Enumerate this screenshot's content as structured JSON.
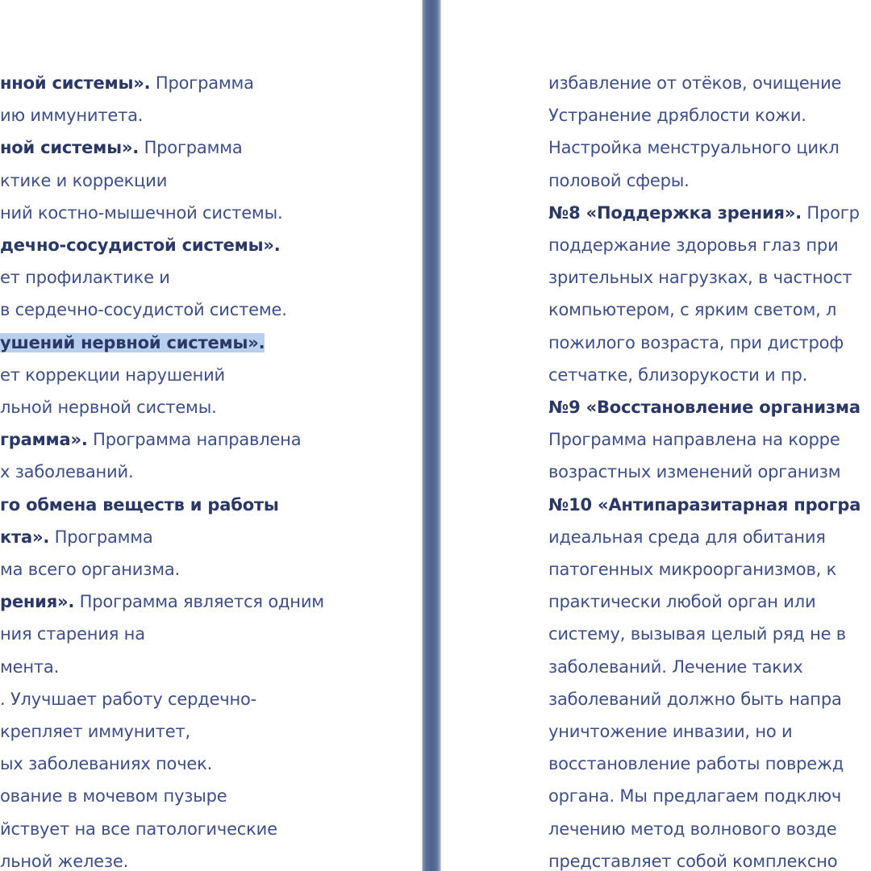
{
  "document": {
    "left_page": [
      [
        {
          "t": "нной системы».",
          "b": true
        },
        {
          "t": " Программа",
          "b": false
        }
      ],
      [
        {
          "t": "ию иммунитета.",
          "b": false
        }
      ],
      [
        {
          "t": "ной системы».",
          "b": true
        },
        {
          "t": " Программа",
          "b": false
        }
      ],
      [
        {
          "t": "ктике и коррекции",
          "b": false
        }
      ],
      [
        {
          "t": "ний костно-мышечной системы.",
          "b": false
        }
      ],
      [
        {
          "t": "дечно-сосудистой системы».",
          "b": true
        }
      ],
      [
        {
          "t": "ет профилактике и",
          "b": false
        }
      ],
      [
        {
          "t": "в сердечно-сосудистой системе.",
          "b": false
        }
      ],
      [
        {
          "t": "ушений нервной системы».",
          "b": true,
          "hl": true
        }
      ],
      [
        {
          "t": "ет коррекции нарушений",
          "b": false
        }
      ],
      [
        {
          "t": "льной нервной системы.",
          "b": false
        }
      ],
      [
        {
          "t": "грамма».",
          "b": true
        },
        {
          "t": " Программа направлена",
          "b": false
        }
      ],
      [
        {
          "t": "х заболеваний.",
          "b": false
        }
      ],
      [
        {
          "t": "го обмена веществ и работы",
          "b": true
        }
      ],
      [
        {
          "t": "кта».",
          "b": true
        },
        {
          "t": " Программа",
          "b": false
        }
      ],
      [
        {
          "t": "ма всего организма.",
          "b": false
        }
      ],
      [
        {
          "t": "рения».",
          "b": true
        },
        {
          "t": " Программа является одним",
          "b": false
        }
      ],
      [
        {
          "t": "ния старения на",
          "b": false
        }
      ],
      [
        {
          "t": "мента.",
          "b": false
        }
      ],
      [
        {
          "t": ". Улучшает работу сердечно-",
          "b": false
        }
      ],
      [
        {
          "t": "крепляет иммунитет,",
          "b": false
        }
      ],
      [
        {
          "t": "ых заболеваниях почек.",
          "b": false
        }
      ],
      [
        {
          "t": "ование в мочевом пузыре",
          "b": false
        }
      ],
      [
        {
          "t": "йствует на все патологические",
          "b": false
        }
      ],
      [
        {
          "t": "льной железе.",
          "b": false
        }
      ]
    ],
    "right_page": [
      [
        {
          "t": "избавление от отёков, очищение",
          "b": false
        }
      ],
      [
        {
          "t": "Устранение дряблости кожи.",
          "b": false
        }
      ],
      [
        {
          "t": "Настройка менструального цикл",
          "b": false
        }
      ],
      [
        {
          "t": "половой сферы.",
          "b": false
        }
      ],
      [
        {
          "t": "№8 «Поддержка зрения».",
          "b": true
        },
        {
          "t": " Прогр",
          "b": false
        }
      ],
      [
        {
          "t": "поддержание здоровья глаз при",
          "b": false
        }
      ],
      [
        {
          "t": "зрительных нагрузках, в частност",
          "b": false
        }
      ],
      [
        {
          "t": "компьютером, с ярким светом, л",
          "b": false
        }
      ],
      [
        {
          "t": "пожилого возраста, при дистроф",
          "b": false
        }
      ],
      [
        {
          "t": "сетчатке, близорукости и пр.",
          "b": false
        }
      ],
      [
        {
          "t": "№9 «Восстановление организма",
          "b": true
        }
      ],
      [
        {
          "t": "Программа направлена на корре",
          "b": false
        }
      ],
      [
        {
          "t": "возрастных изменений организм",
          "b": false
        }
      ],
      [
        {
          "t": "№10 «Антипаразитарная програ",
          "b": true
        }
      ],
      [
        {
          "t": "идеальная среда для обитания",
          "b": false
        }
      ],
      [
        {
          "t": "патогенных микроорганизмов, к",
          "b": false
        }
      ],
      [
        {
          "t": "практически любой орган или",
          "b": false
        }
      ],
      [
        {
          "t": "систему, вызывая целый ряд не в",
          "b": false
        }
      ],
      [
        {
          "t": "заболеваний. Лечение таких",
          "b": false
        }
      ],
      [
        {
          "t": "заболеваний должно быть напра",
          "b": false
        }
      ],
      [
        {
          "t": "уничтожение инвазии, но и",
          "b": false
        }
      ],
      [
        {
          "t": "восстановление работы поврежд",
          "b": false
        }
      ],
      [
        {
          "t": "органа. Мы предлагаем подключ",
          "b": false
        }
      ],
      [
        {
          "t": "лечению метод волнового возде",
          "b": false
        }
      ],
      [
        {
          "t": "представляет собой комплексно",
          "b": false
        }
      ]
    ]
  },
  "colors": {
    "text": "#3f4f86",
    "bold_text": "#2b3866",
    "selection": "#b8d0ee",
    "page_gap": "#4d6390"
  }
}
